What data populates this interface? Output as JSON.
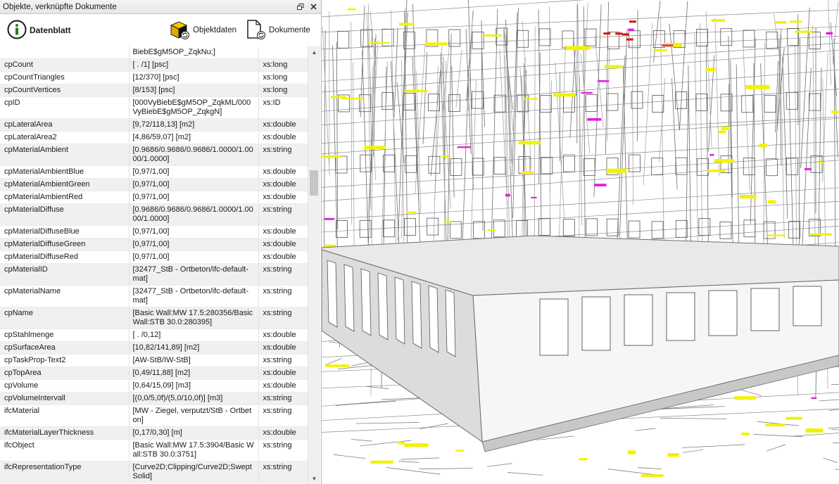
{
  "panel": {
    "title": "Objekte, verknüpfte Dokumente",
    "toolbar": {
      "datenblatt": "Datenblatt",
      "objektdaten": "Objektdaten",
      "dokumente": "Dokumente"
    }
  },
  "properties": [
    {
      "name": "",
      "value": "BiebE$gM5OP_ZqkNu;]",
      "type": ""
    },
    {
      "name": "cpCount",
      "value": "[ . /1] [psc]",
      "type": "xs:long"
    },
    {
      "name": "cpCountTriangles",
      "value": "[12/370] [psc]",
      "type": "xs:long"
    },
    {
      "name": "cpCountVertices",
      "value": "[8/153] [psc]",
      "type": "xs:long"
    },
    {
      "name": "cpID",
      "value": "[000VyBiebE$gM5OP_ZqkML/000VyBiebE$gM5OP_ZqkgN]",
      "type": "xs:ID"
    },
    {
      "name": "cpLateralArea",
      "value": "[9,72/118,13] [m2]",
      "type": "xs:double"
    },
    {
      "name": "cpLateralArea2",
      "value": "[4,86/59,07] [m2]",
      "type": "xs:double"
    },
    {
      "name": "cpMaterialAmbient",
      "value": "[0.9686/0.9686/0.9686/1.0000/1.0000/1.0000]",
      "type": "xs:string"
    },
    {
      "name": "cpMaterialAmbientBlue",
      "value": "[0,97/1,00]",
      "type": "xs:double"
    },
    {
      "name": "cpMaterialAmbientGreen",
      "value": "[0,97/1,00]",
      "type": "xs:double"
    },
    {
      "name": "cpMaterialAmbientRed",
      "value": "[0,97/1,00]",
      "type": "xs:double"
    },
    {
      "name": "cpMaterialDiffuse",
      "value": "[0.9686/0.9686/0.9686/1.0000/1.0000/1.0000]",
      "type": "xs:string"
    },
    {
      "name": "cpMaterialDiffuseBlue",
      "value": "[0,97/1,00]",
      "type": "xs:double"
    },
    {
      "name": "cpMaterialDiffuseGreen",
      "value": "[0,97/1,00]",
      "type": "xs:double"
    },
    {
      "name": "cpMaterialDiffuseRed",
      "value": "[0,97/1,00]",
      "type": "xs:double"
    },
    {
      "name": "cpMaterialID",
      "value": "[32477_StB - Ortbeton/ifc-default-mat]",
      "type": "xs:string"
    },
    {
      "name": "cpMaterialName",
      "value": "[32477_StB - Ortbeton/ifc-default-mat]",
      "type": "xs:string"
    },
    {
      "name": "cpName",
      "value": "[Basic Wall:MW 17.5:280356/Basic Wall:STB 30.0:280395]",
      "type": "xs:string"
    },
    {
      "name": "cpStahlmenge",
      "value": "[ . /0,12]",
      "type": "xs:double"
    },
    {
      "name": "cpSurfaceArea",
      "value": "[10,82/141,89] [m2]",
      "type": "xs:double"
    },
    {
      "name": "cpTaskProp-Text2",
      "value": "[AW-StB/IW-StB]",
      "type": "xs:string"
    },
    {
      "name": "cpTopArea",
      "value": "[0,49/11,88] [m2]",
      "type": "xs:double"
    },
    {
      "name": "cpVolume",
      "value": "[0,64/15,09] [m3]",
      "type": "xs:double"
    },
    {
      "name": "cpVolumeIntervall",
      "value": "[(0,0/5,0f)/(5,0/10,0f)] [m3]",
      "type": "xs:string"
    },
    {
      "name": "ifcMaterial",
      "value": "[MW - Ziegel, verputzt/StB - Ortbeton]",
      "type": "xs:string"
    },
    {
      "name": "ifcMaterialLayerThickness",
      "value": "[0,17/0,30] [m]",
      "type": "xs:double"
    },
    {
      "name": "ifcObject",
      "value": "[Basic Wall:MW 17.5:3904/Basic Wall:STB 30.0:3751]",
      "type": "xs:string"
    },
    {
      "name": "ifcRepresentationType",
      "value": "[Curve2D;Clipping/Curve2D;SweptSolid]",
      "type": "xs:string"
    }
  ],
  "icons": {
    "info": "info-icon",
    "objektdaten": "box-refresh-icon",
    "dokumente": "document-refresh-icon",
    "float": "float-window-icon",
    "close": "close-icon"
  },
  "colors": {
    "highlight_yellow": "#f2f200",
    "highlight_magenta": "#e020e0",
    "highlight_red": "#e01010"
  }
}
